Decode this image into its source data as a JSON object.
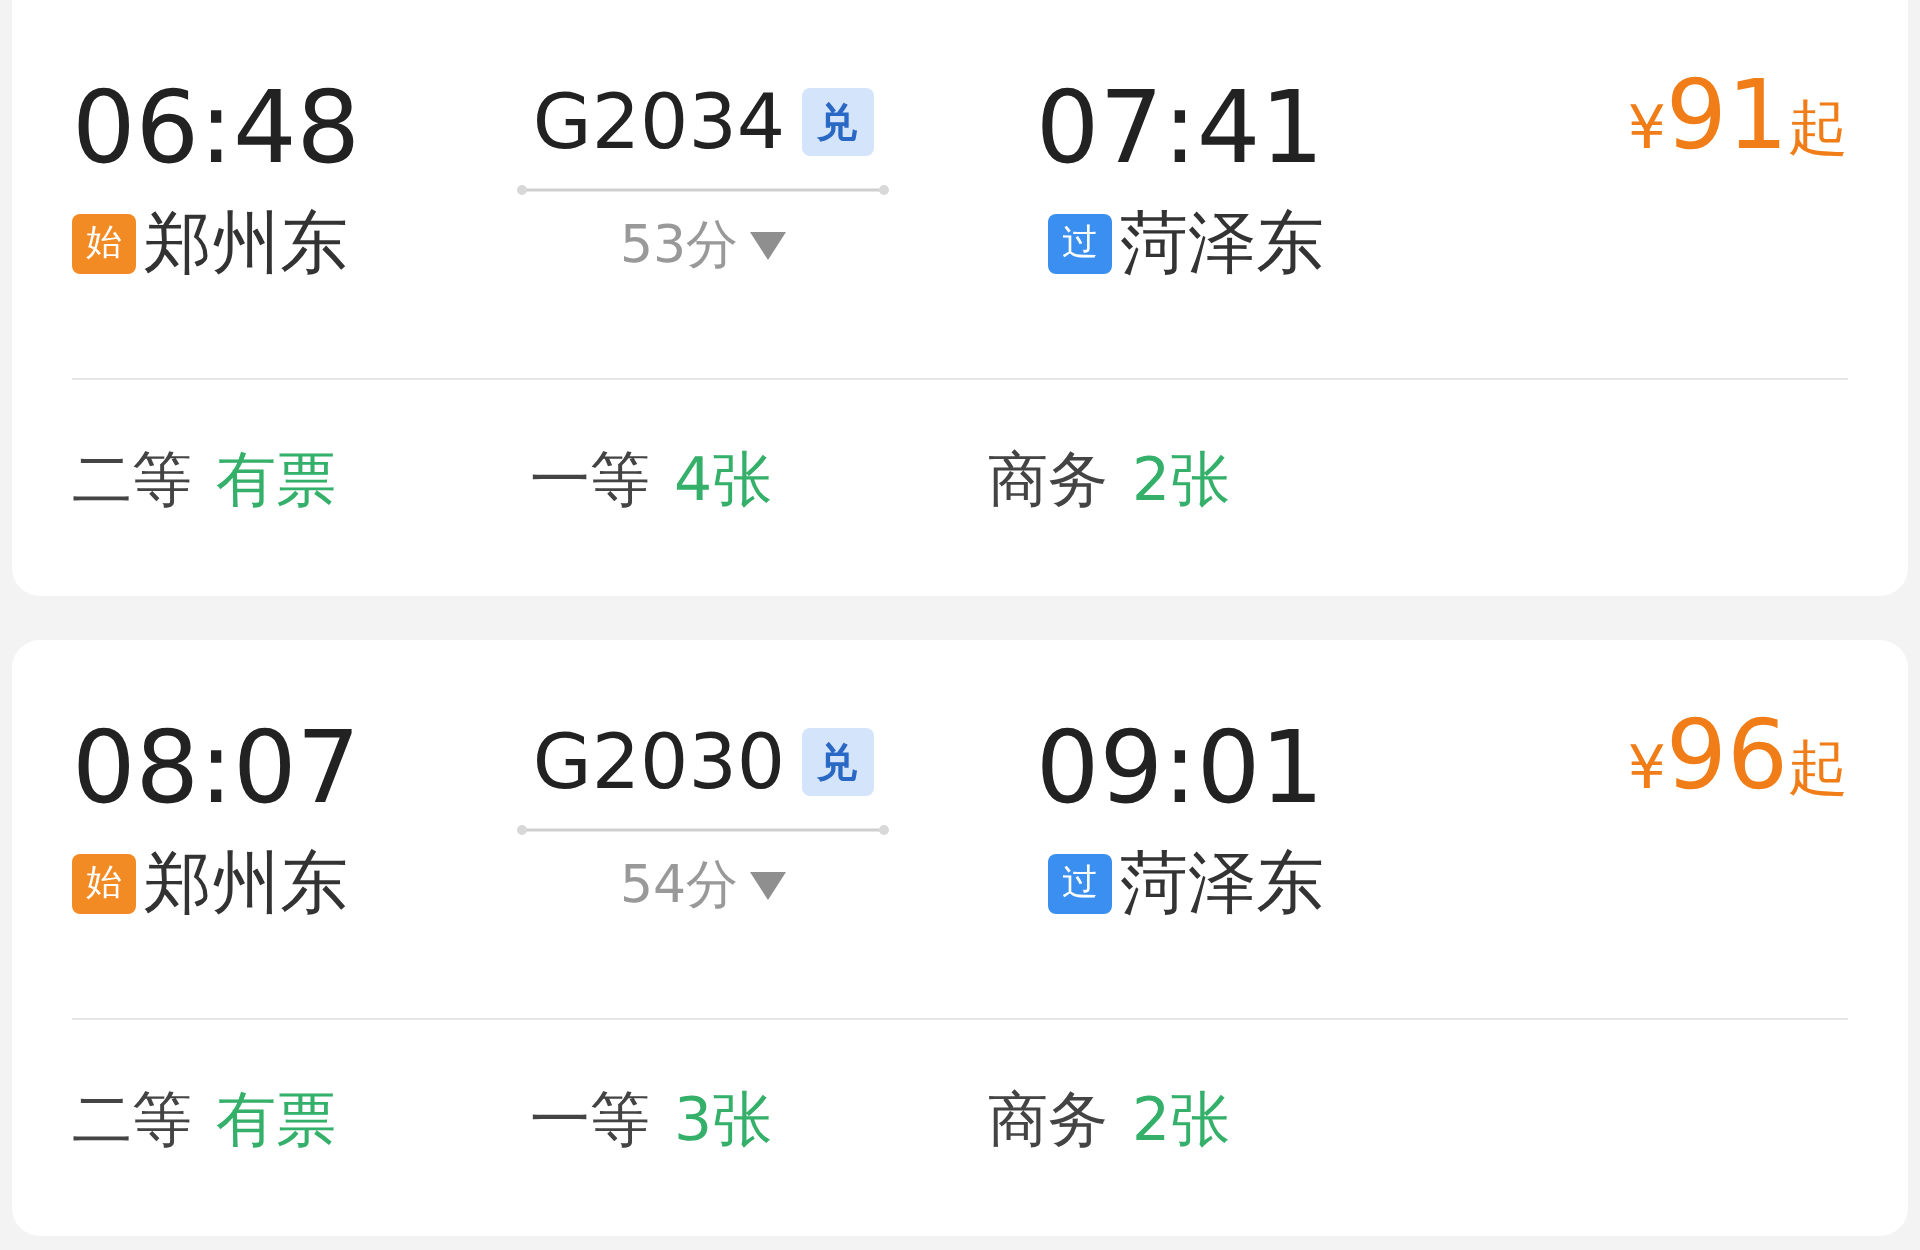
{
  "trains": [
    {
      "departure": {
        "time": "06:48",
        "badge": {
          "text": "始",
          "kind": "start"
        },
        "station": "郑州东"
      },
      "train_no": "G2034",
      "tag": "兑",
      "duration": "53分",
      "arrival": {
        "time": "07:41",
        "badge": {
          "text": "过",
          "kind": "pass"
        },
        "station": "菏泽东"
      },
      "price": {
        "currency": "¥",
        "amount": "91",
        "suffix": "起"
      },
      "seats": [
        {
          "class": "二等",
          "availability": "有票"
        },
        {
          "class": "一等",
          "availability": "4张"
        },
        {
          "class": "商务",
          "availability": "2张"
        }
      ]
    },
    {
      "departure": {
        "time": "08:07",
        "badge": {
          "text": "始",
          "kind": "start"
        },
        "station": "郑州东"
      },
      "train_no": "G2030",
      "tag": "兑",
      "duration": "54分",
      "arrival": {
        "time": "09:01",
        "badge": {
          "text": "过",
          "kind": "pass"
        },
        "station": "菏泽东"
      },
      "price": {
        "currency": "¥",
        "amount": "96",
        "suffix": "起"
      },
      "seats": [
        {
          "class": "二等",
          "availability": "有票"
        },
        {
          "class": "一等",
          "availability": "3张"
        },
        {
          "class": "商务",
          "availability": "2张"
        }
      ]
    }
  ]
}
